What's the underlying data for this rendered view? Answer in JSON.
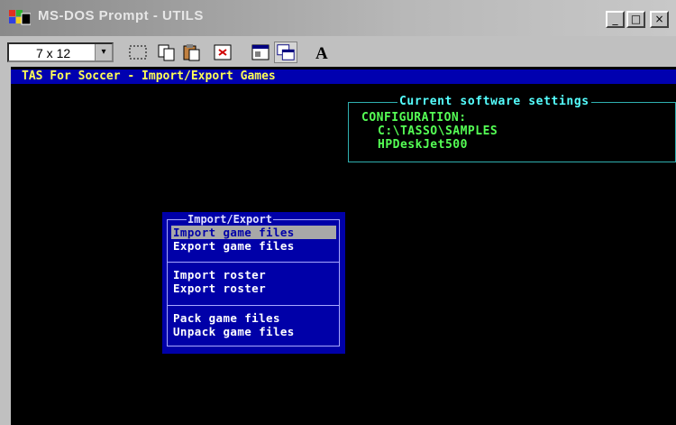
{
  "window": {
    "title": "MS-DOS Prompt - UTILS",
    "buttons": {
      "minimize": "_",
      "maximize": "□",
      "close": "×"
    }
  },
  "toolbar": {
    "font_size": "7 x 12",
    "dropdown_glyph": "▾",
    "font_button_label": "A",
    "buttons": [
      "mark",
      "copy",
      "paste",
      "fullscreen",
      "properties",
      "background",
      "font"
    ]
  },
  "console": {
    "header": "TAS For Soccer - Import/Export Games",
    "settings": {
      "title": "Current software settings",
      "configuration_label": "CONFIGURATION:",
      "path": "C:\\TASSO\\SAMPLES",
      "printer": "HPDeskJet500"
    },
    "menu": {
      "title": "Import/Export",
      "groups": [
        [
          "Import game files",
          "Export game files"
        ],
        [
          "Import roster",
          "Export roster"
        ],
        [
          "Pack game files",
          "Unpack game files"
        ]
      ],
      "selected": "Import game files"
    }
  },
  "colors": {
    "console_bg": "#000000",
    "header_bg": "#0000b0",
    "header_text": "#ffff55",
    "settings_title": "#55ffff",
    "settings_text": "#55ff55",
    "menu_bg": "#0000a8",
    "menu_highlight": "#a8a8a8"
  }
}
